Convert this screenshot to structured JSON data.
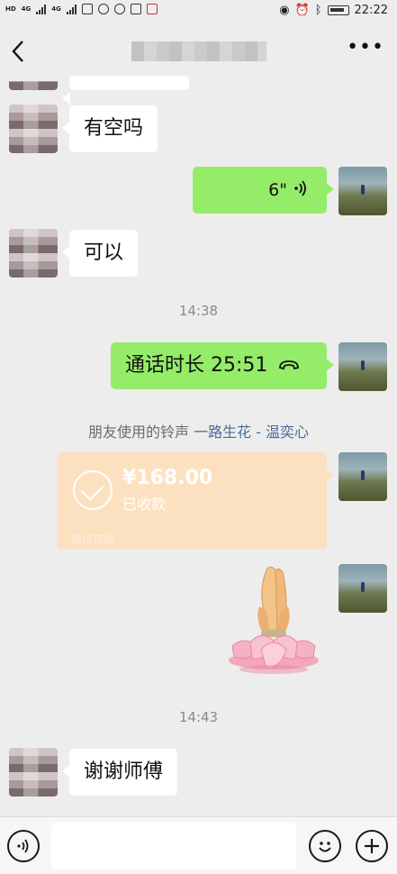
{
  "status_bar": {
    "time": "22:22",
    "network_left": "HD",
    "network_types": [
      "4G",
      "4G"
    ],
    "icons": [
      "hd-icon",
      "signal-icon",
      "signal-icon",
      "mail-icon",
      "app-icon",
      "app-icon",
      "upload-icon",
      "app-icon"
    ],
    "right_icons": [
      "eye-icon",
      "alarm-icon",
      "bluetooth-icon",
      "battery-icon"
    ]
  },
  "header": {
    "back_icon": "chevron-left-icon",
    "title": "",
    "more_icon": "more-icon"
  },
  "messages": [
    {
      "type": "text",
      "side": "left",
      "text": "有空吗"
    },
    {
      "type": "voice",
      "side": "right",
      "duration": "6\"",
      "icon": "voice-wave-icon"
    },
    {
      "type": "text",
      "side": "left",
      "text": "可以"
    },
    {
      "type": "timestamp",
      "text": "14:38"
    },
    {
      "type": "call",
      "side": "right",
      "text": "通话时长 25:51",
      "icon": "phone-hangup-icon"
    },
    {
      "type": "system",
      "prefix": "朋友使用的铃声",
      "song": "一路生花 - 温奕心"
    },
    {
      "type": "transfer",
      "side": "right",
      "amount": "¥168.00",
      "status": "已收款",
      "footer": "微信转账"
    },
    {
      "type": "sticker",
      "side": "right",
      "name": "praying-hands-lotus-sticker"
    },
    {
      "type": "timestamp",
      "text": "14:43"
    },
    {
      "type": "text",
      "side": "left",
      "text": "谢谢师傅"
    }
  ],
  "input_bar": {
    "voice_icon": "voice-mode-icon",
    "input_value": "",
    "emoji_icon": "emoji-icon",
    "plus_icon": "plus-icon"
  },
  "colors": {
    "background": "#ededed",
    "self_bubble": "#95ec69",
    "friend_bubble": "#ffffff",
    "transfer_card": "#fce1c0",
    "song_link": "#4a6a9c"
  }
}
